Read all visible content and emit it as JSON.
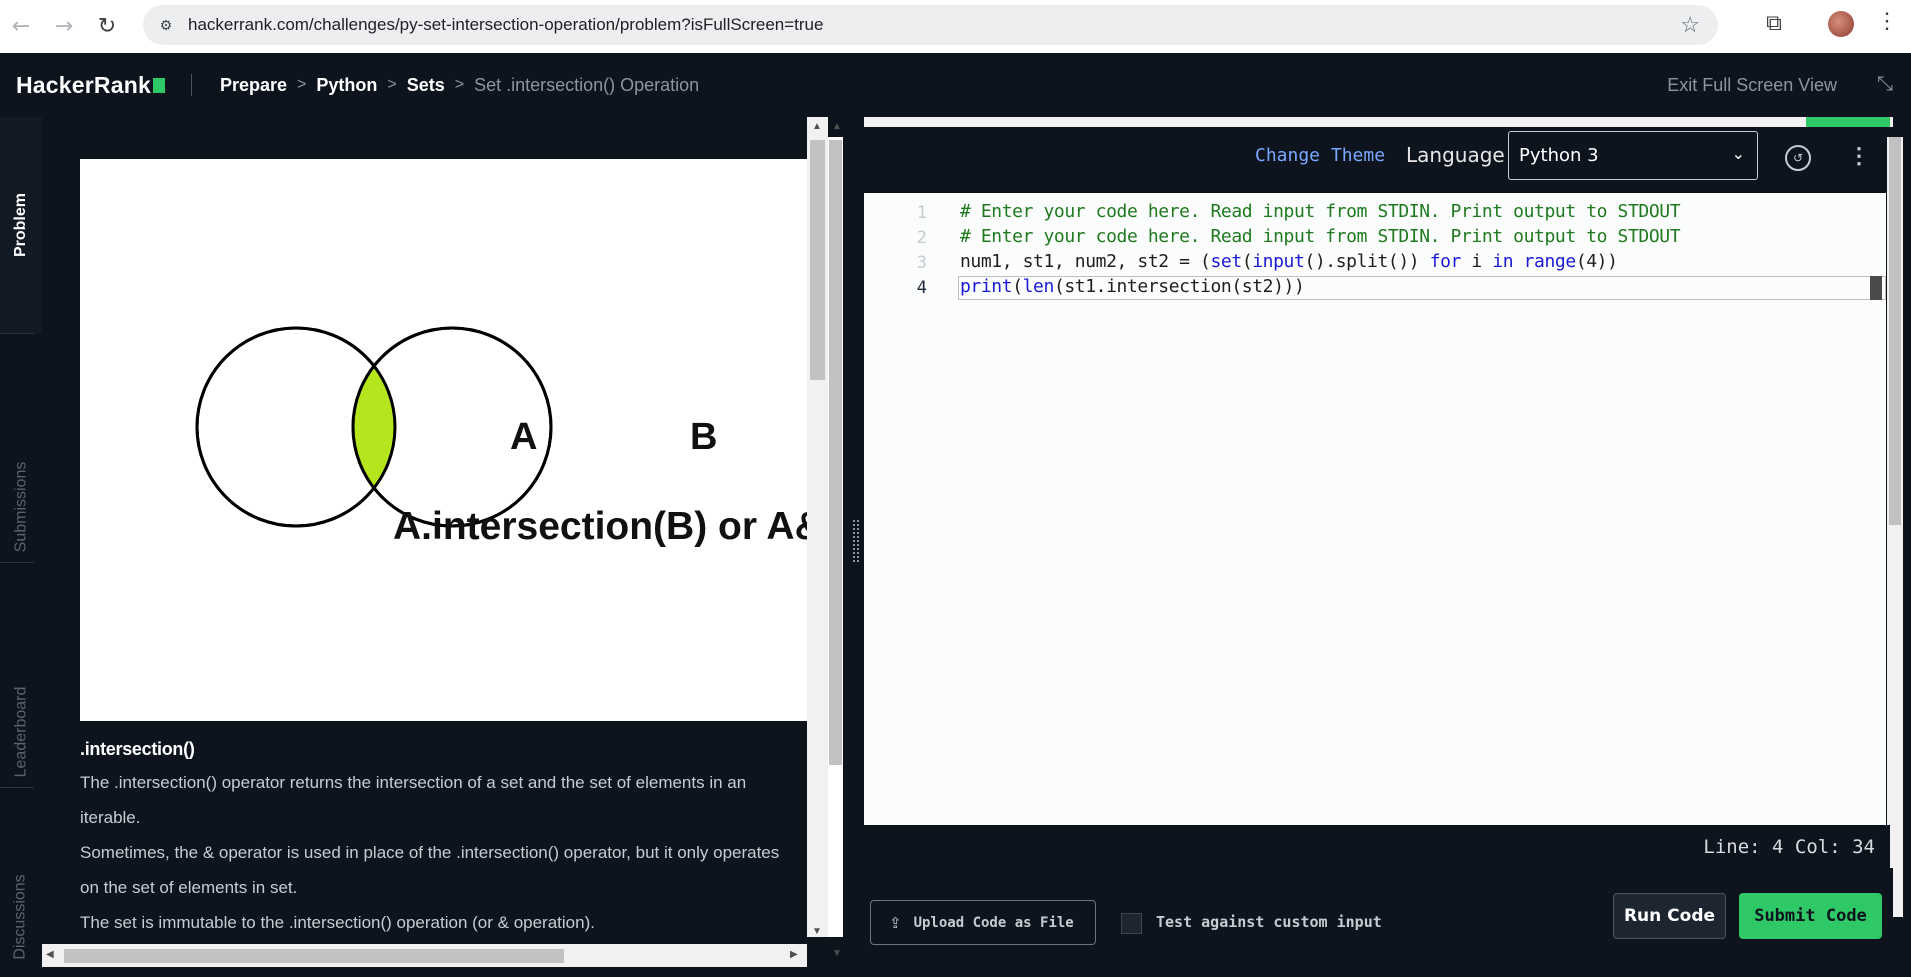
{
  "browser": {
    "url": "hackerrank.com/challenges/py-set-intersection-operation/problem?isFullScreen=true"
  },
  "header": {
    "logo": "HackerRank",
    "breadcrumb": [
      "Prepare",
      "Python",
      "Sets",
      "Set .intersection() Operation"
    ],
    "exit_fullscreen": "Exit Full Screen View"
  },
  "side_tabs": [
    "Problem",
    "Submissions",
    "Leaderboard",
    "Discussions"
  ],
  "problem": {
    "diagram": {
      "label_a": "A",
      "label_b": "B",
      "caption": "A.intersection(B) or A&B",
      "highlight_color": "#b5e61d"
    },
    "heading": ".intersection()",
    "paragraphs": [
      "The .intersection() operator returns the intersection of a set and the set of elements in an iterable.",
      "Sometimes, the & operator is used in place of the .intersection() operator, but it only operates on the set of elements in set.",
      "The set is immutable to the .intersection() operation (or & operation)."
    ]
  },
  "editor": {
    "change_theme": "Change Theme",
    "language_label": "Language",
    "language_value": "Python 3",
    "line_numbers": [
      "1",
      "2",
      "3",
      "4"
    ],
    "status": "Line: 4 Col: 34"
  },
  "footer": {
    "upload": "Upload Code as File",
    "custom_input": "Test against custom input",
    "run": "Run Code",
    "submit": "Submit Code"
  },
  "colors": {
    "accent": "#2ec866",
    "link": "#7aa7ff",
    "background": "#0e141e"
  }
}
